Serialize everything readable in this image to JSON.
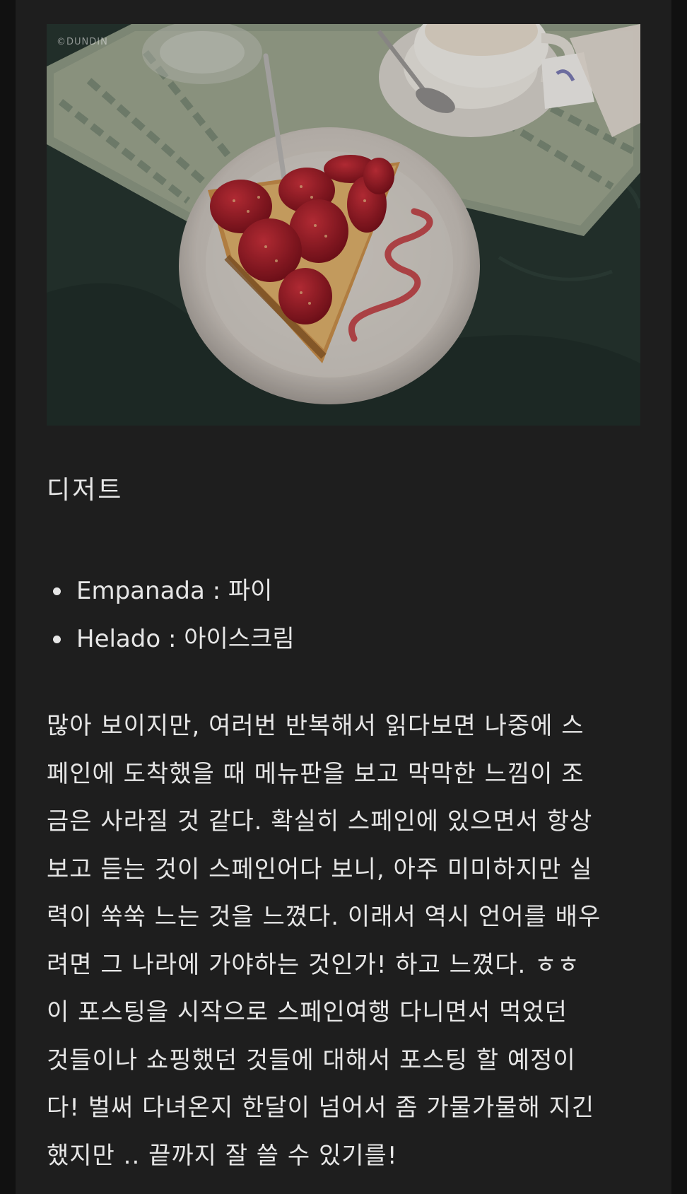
{
  "photo": {
    "watermark": "©DUNDIN",
    "alt": "Strawberry tart slice on a white plate with syrup drizzle next to a cup of coffee"
  },
  "section": {
    "heading": "디저트",
    "items": [
      {
        "spanish": "Empanada",
        "separator": " : ",
        "korean": "파이"
      },
      {
        "spanish": "Helado",
        "separator": " : ",
        "korean": "아이스크림"
      }
    ]
  },
  "paragraph": {
    "lines": [
      "많아 보이지만, 여러번 반복해서 읽다보면 나중에 스",
      "페인에 도착했을 때 메뉴판을 보고 막막한 느낌이 조",
      "금은 사라질 것 같다. 확실히 스페인에 있으면서 항상",
      "보고 듣는 것이 스페인어다 보니, 아주 미미하지만 실",
      "력이 쑥쑥 느는 것을 느꼈다. 이래서 역시 언어를 배우",
      "려면 그 나라에 가야하는 것인가! 하고 느꼈다. ㅎㅎ",
      "이 포스팅을 시작으로 스페인여행 다니면서 먹었던",
      "것들이나 쇼핑했던 것들에 대해서 포스팅 할 예정이",
      "다! 벌써 다녀온지 한달이 넘어서 좀 가물가물해 지긴",
      "했지만 .. 끝까지 잘 쓸 수 있기를!"
    ]
  },
  "colors": {
    "background": "#1e1e1e",
    "text": "#e6e6e6"
  }
}
